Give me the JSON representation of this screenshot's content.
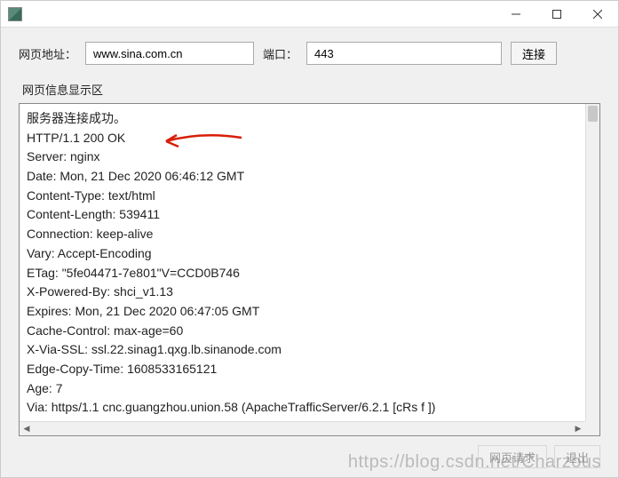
{
  "form": {
    "url_label": "网页地址：",
    "url_value": "www.sina.com.cn",
    "port_label": "端口：",
    "port_value": "443",
    "connect_label": "连接"
  },
  "section_label": "网页信息显示区",
  "response_lines": [
    "服务器连接成功。",
    "HTTP/1.1 200 OK",
    "Server: nginx",
    "Date: Mon, 21 Dec 2020 06:46:12 GMT",
    "Content-Type: text/html",
    "Content-Length: 539411",
    "Connection: keep-alive",
    "Vary: Accept-Encoding",
    "ETag: \"5fe04471-7e801\"V=CCD0B746",
    "X-Powered-By: shci_v1.13",
    "Expires: Mon, 21 Dec 2020 06:47:05 GMT",
    "Cache-Control: max-age=60",
    "X-Via-SSL: ssl.22.sinag1.qxg.lb.sinanode.com",
    "Edge-Copy-Time: 1608533165121",
    "Age: 7",
    "Via: https/1.1 cnc.guangzhou.union.58 (ApacheTrafficServer/6.2.1 [cRs f ])"
  ],
  "bottom": {
    "btn1": "网页请求",
    "btn2": "退出"
  },
  "watermark": "https://blog.csdn.net/Charzous",
  "annotation_color": "#d81e06"
}
